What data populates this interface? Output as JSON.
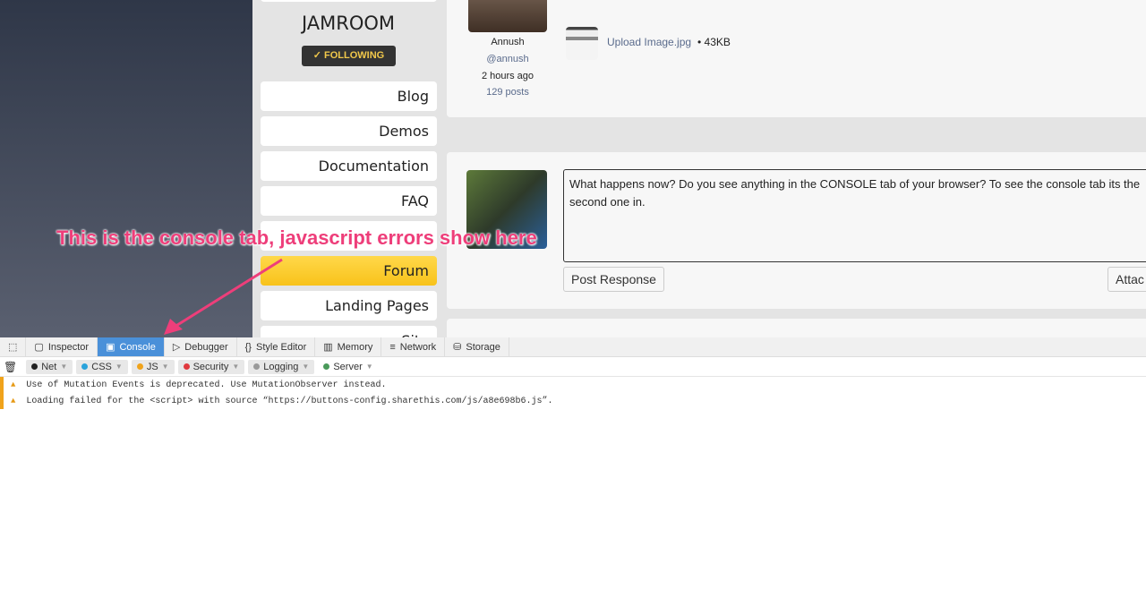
{
  "site": {
    "brand": "JAMROOM",
    "following": "✓ FOLLOWING",
    "nav": [
      {
        "label": "Blog"
      },
      {
        "label": "Demos"
      },
      {
        "label": "Documentation"
      },
      {
        "label": "FAQ"
      },
      {
        "label": ""
      },
      {
        "label": "Forum"
      },
      {
        "label": "Landing Pages"
      },
      {
        "label": "Site"
      }
    ],
    "post": {
      "user": "Annush",
      "handle": "@annush",
      "time": "2 hours ago",
      "posts": "129 posts",
      "attachment": "Upload Image.jpg",
      "size": "43KB"
    },
    "reply": {
      "text": "What happens now?  Do you see anything in the CONSOLE tab of your browser?  To see the console tab its the second one in.",
      "post_button": "Post Response",
      "attach_button": "Attac"
    }
  },
  "annotation": "This is the console tab, javascript errors show here",
  "devtools": {
    "tabs": [
      "Inspector",
      "Console",
      "Debugger",
      "Style Editor",
      "Memory",
      "Network",
      "Storage"
    ],
    "filters": [
      {
        "label": "Net",
        "color": "#222222"
      },
      {
        "label": "CSS",
        "color": "#2aa3db"
      },
      {
        "label": "JS",
        "color": "#f0a31b"
      },
      {
        "label": "Security",
        "color": "#e0393e"
      },
      {
        "label": "Logging",
        "color": "#999999"
      },
      {
        "label": "Server",
        "color": "#4a9a5a"
      }
    ],
    "messages": [
      "Use of Mutation Events is deprecated. Use MutationObserver instead.",
      "Loading failed for the <script> with source “https://buttons-config.sharethis.com/js/a8e698b6.js”."
    ]
  }
}
